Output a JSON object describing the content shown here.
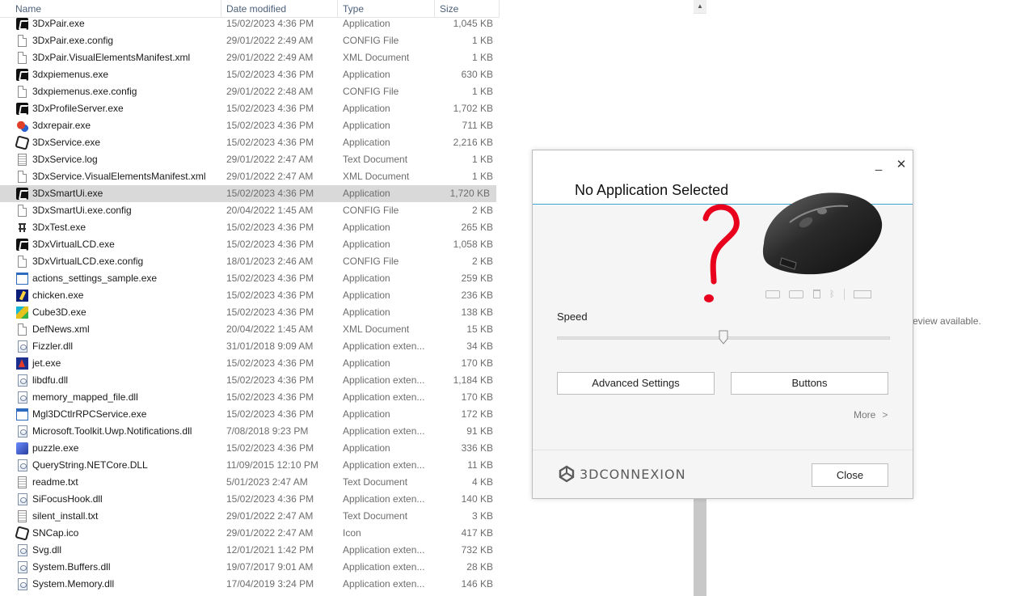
{
  "explorer": {
    "columns": {
      "name": "Name",
      "date": "Date modified",
      "type": "Type",
      "size": "Size"
    },
    "files": [
      {
        "name": "3DxPair.exe",
        "date": "15/02/2023 4:36 PM",
        "type": "Application",
        "size": "1,045 KB",
        "icon": "3dx-app-icon"
      },
      {
        "name": "3DxPair.exe.config",
        "date": "29/01/2022 2:49 AM",
        "type": "CONFIG File",
        "size": "1 KB",
        "icon": "file-icon"
      },
      {
        "name": "3DxPair.VisualElementsManifest.xml",
        "date": "29/01/2022 2:49 AM",
        "type": "XML Document",
        "size": "1 KB",
        "icon": "file-icon"
      },
      {
        "name": "3dxpiemenus.exe",
        "date": "15/02/2023 4:36 PM",
        "type": "Application",
        "size": "630 KB",
        "icon": "3dx-app-icon"
      },
      {
        "name": "3dxpiemenus.exe.config",
        "date": "29/01/2022 2:48 AM",
        "type": "CONFIG File",
        "size": "1 KB",
        "icon": "file-icon"
      },
      {
        "name": "3DxProfileServer.exe",
        "date": "15/02/2023 4:36 PM",
        "type": "Application",
        "size": "1,702 KB",
        "icon": "3dx-app-icon"
      },
      {
        "name": "3dxrepair.exe",
        "date": "15/02/2023 4:36 PM",
        "type": "Application",
        "size": "711 KB",
        "icon": "repair-icon"
      },
      {
        "name": "3DxService.exe",
        "date": "15/02/2023 4:36 PM",
        "type": "Application",
        "size": "2,216 KB",
        "icon": "3dx-outline-icon"
      },
      {
        "name": "3DxService.log",
        "date": "29/01/2022 2:47 AM",
        "type": "Text Document",
        "size": "1 KB",
        "icon": "text-file-icon"
      },
      {
        "name": "3DxService.VisualElementsManifest.xml",
        "date": "29/01/2022 2:47 AM",
        "type": "XML Document",
        "size": "1 KB",
        "icon": "file-icon"
      },
      {
        "name": "3DxSmartUi.exe",
        "date": "15/02/2023 4:36 PM",
        "type": "Application",
        "size": "1,720 KB",
        "icon": "3dx-app-icon",
        "selected": true
      },
      {
        "name": "3DxSmartUi.exe.config",
        "date": "20/04/2022 1:45 AM",
        "type": "CONFIG File",
        "size": "2 KB",
        "icon": "file-icon"
      },
      {
        "name": "3DxTest.exe",
        "date": "15/02/2023 4:36 PM",
        "type": "Application",
        "size": "265 KB",
        "icon": "test-app-icon"
      },
      {
        "name": "3DxVirtualLCD.exe",
        "date": "15/02/2023 4:36 PM",
        "type": "Application",
        "size": "1,058 KB",
        "icon": "3dx-app-icon"
      },
      {
        "name": "3DxVirtualLCD.exe.config",
        "date": "18/01/2023 2:46 AM",
        "type": "CONFIG File",
        "size": "2 KB",
        "icon": "file-icon"
      },
      {
        "name": "actions_settings_sample.exe",
        "date": "15/02/2023 4:36 PM",
        "type": "Application",
        "size": "259 KB",
        "icon": "window-app-icon"
      },
      {
        "name": "chicken.exe",
        "date": "15/02/2023 4:36 PM",
        "type": "Application",
        "size": "236 KB",
        "icon": "chicken-app-icon"
      },
      {
        "name": "Cube3D.exe",
        "date": "15/02/2023 4:36 PM",
        "type": "Application",
        "size": "138 KB",
        "icon": "cube-app-icon"
      },
      {
        "name": "DefNews.xml",
        "date": "20/04/2022 1:45 AM",
        "type": "XML Document",
        "size": "15 KB",
        "icon": "file-icon"
      },
      {
        "name": "Fizzler.dll",
        "date": "31/01/2018 9:09 AM",
        "type": "Application exten...",
        "size": "34 KB",
        "icon": "dll-icon"
      },
      {
        "name": "jet.exe",
        "date": "15/02/2023 4:36 PM",
        "type": "Application",
        "size": "170 KB",
        "icon": "jet-app-icon"
      },
      {
        "name": "libdfu.dll",
        "date": "15/02/2023 4:36 PM",
        "type": "Application exten...",
        "size": "1,184 KB",
        "icon": "dll-icon"
      },
      {
        "name": "memory_mapped_file.dll",
        "date": "15/02/2023 4:36 PM",
        "type": "Application exten...",
        "size": "170 KB",
        "icon": "dll-icon"
      },
      {
        "name": "Mgl3DCtlrRPCService.exe",
        "date": "15/02/2023 4:36 PM",
        "type": "Application",
        "size": "172 KB",
        "icon": "service-app-icon"
      },
      {
        "name": "Microsoft.Toolkit.Uwp.Notifications.dll",
        "date": "7/08/2018 9:23 PM",
        "type": "Application exten...",
        "size": "91 KB",
        "icon": "dll-icon"
      },
      {
        "name": "puzzle.exe",
        "date": "15/02/2023 4:36 PM",
        "type": "Application",
        "size": "336 KB",
        "icon": "puzzle-app-icon"
      },
      {
        "name": "QueryString.NETCore.DLL",
        "date": "11/09/2015 12:10 PM",
        "type": "Application exten...",
        "size": "11 KB",
        "icon": "dll-icon"
      },
      {
        "name": "readme.txt",
        "date": "5/01/2023 2:47 AM",
        "type": "Text Document",
        "size": "4 KB",
        "icon": "text-file-icon"
      },
      {
        "name": "SiFocusHook.dll",
        "date": "15/02/2023 4:36 PM",
        "type": "Application exten...",
        "size": "140 KB",
        "icon": "dll-icon"
      },
      {
        "name": "silent_install.txt",
        "date": "29/01/2022 2:47 AM",
        "type": "Text Document",
        "size": "3 KB",
        "icon": "text-file-icon"
      },
      {
        "name": "SNCap.ico",
        "date": "29/01/2022 2:47 AM",
        "type": "Icon",
        "size": "417 KB",
        "icon": "3dx-outline-icon"
      },
      {
        "name": "Svg.dll",
        "date": "12/01/2021 1:42 PM",
        "type": "Application exten...",
        "size": "732 KB",
        "icon": "dll-icon"
      },
      {
        "name": "System.Buffers.dll",
        "date": "19/07/2017 9:01 AM",
        "type": "Application exten...",
        "size": "28 KB",
        "icon": "dll-icon"
      },
      {
        "name": "System.Memory.dll",
        "date": "17/04/2019 3:24 PM",
        "type": "Application exten...",
        "size": "146 KB",
        "icon": "dll-icon"
      }
    ],
    "preview_text": "eview available."
  },
  "dialog": {
    "title": "No Application Selected",
    "minimize_glyph": "_",
    "close_glyph": "✕",
    "speed_label": "Speed",
    "speed_value": 0.5,
    "advanced_settings_label": "Advanced Settings",
    "buttons_label": "Buttons",
    "more_label": "More",
    "more_chevron": ">",
    "brand_text": "3DCONNEXION",
    "close_label": "Close",
    "colors": {
      "accent_line": "#3aa0d0",
      "question_mark": "#e8001c",
      "body_bg": "#f5f5f5"
    }
  }
}
